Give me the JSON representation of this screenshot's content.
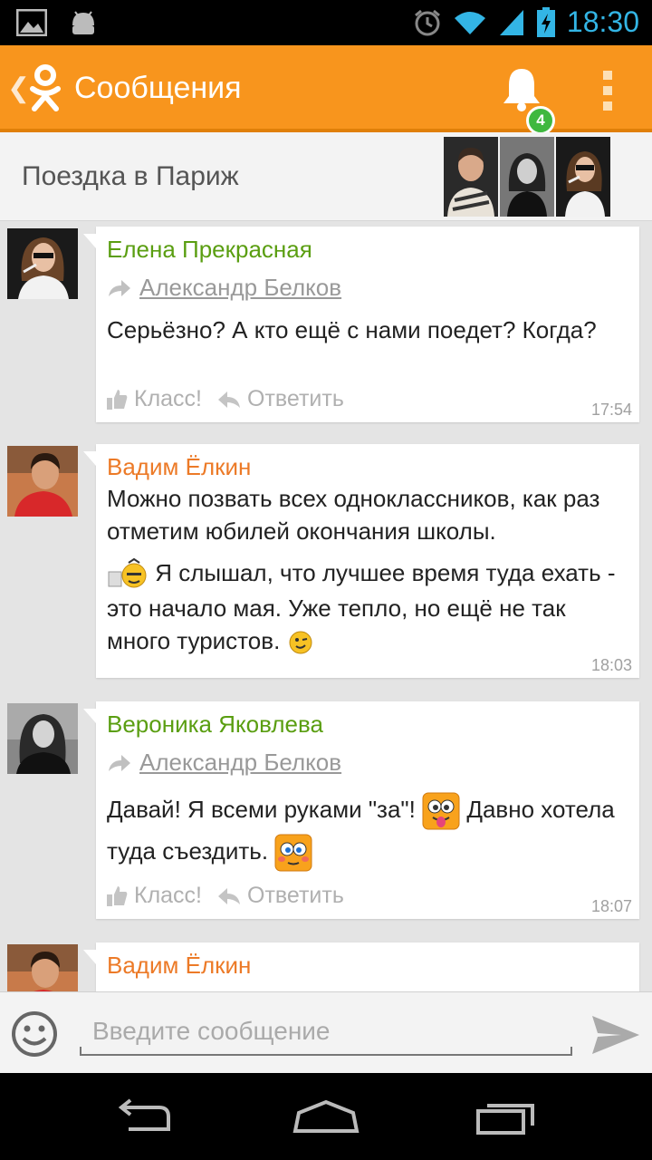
{
  "status_bar": {
    "time": "18:30",
    "left_icons": [
      "gallery-icon",
      "android-icon"
    ],
    "right_icons": [
      "alarm-icon",
      "wifi-icon",
      "signal-icon",
      "battery-charging-icon"
    ],
    "accent_color": "#33b5e5"
  },
  "action_bar": {
    "title": "Сообщения",
    "notification_count": "4",
    "brand_color": "#f8951d",
    "badge_color": "#3fb83f"
  },
  "conversation": {
    "title": "Поездка в Париж",
    "participants": [
      "avatar-man",
      "avatar-woman-bw",
      "avatar-woman-sunglasses"
    ]
  },
  "messages": [
    {
      "author": "Елена Прекрасная",
      "author_color": "#5a9e11",
      "forwarded_from": "Александр Белков",
      "text": "Серьёзно? А кто ещё с нами поедет? Когда?",
      "like_label": "Класс!",
      "reply_label": "Ответить",
      "time": "17:54"
    },
    {
      "author": "Вадим Ёлкин",
      "author_color": "#ec7a27",
      "paragraph1": "Можно позвать всех одноклассников, как раз отметим юбилей окончания школы.",
      "paragraph2": "Я слышал, что лучшее время туда ехать - это начало мая. Уже тепло, но ещё не так много туристов.",
      "time": "18:03"
    },
    {
      "author": "Вероника Яковлева",
      "author_color": "#5a9e11",
      "forwarded_from": "Александр Белков",
      "text_part1": "Давай! Я всеми руками \"за\"!",
      "text_part2": "Давно хотела туда съездить.",
      "like_label": "Класс!",
      "reply_label": "Ответить",
      "time": "18:07"
    },
    {
      "author": "Вадим Ёлкин",
      "author_color": "#ec7a27"
    }
  ],
  "input_bar": {
    "placeholder": "Введите сообщение",
    "value": ""
  }
}
